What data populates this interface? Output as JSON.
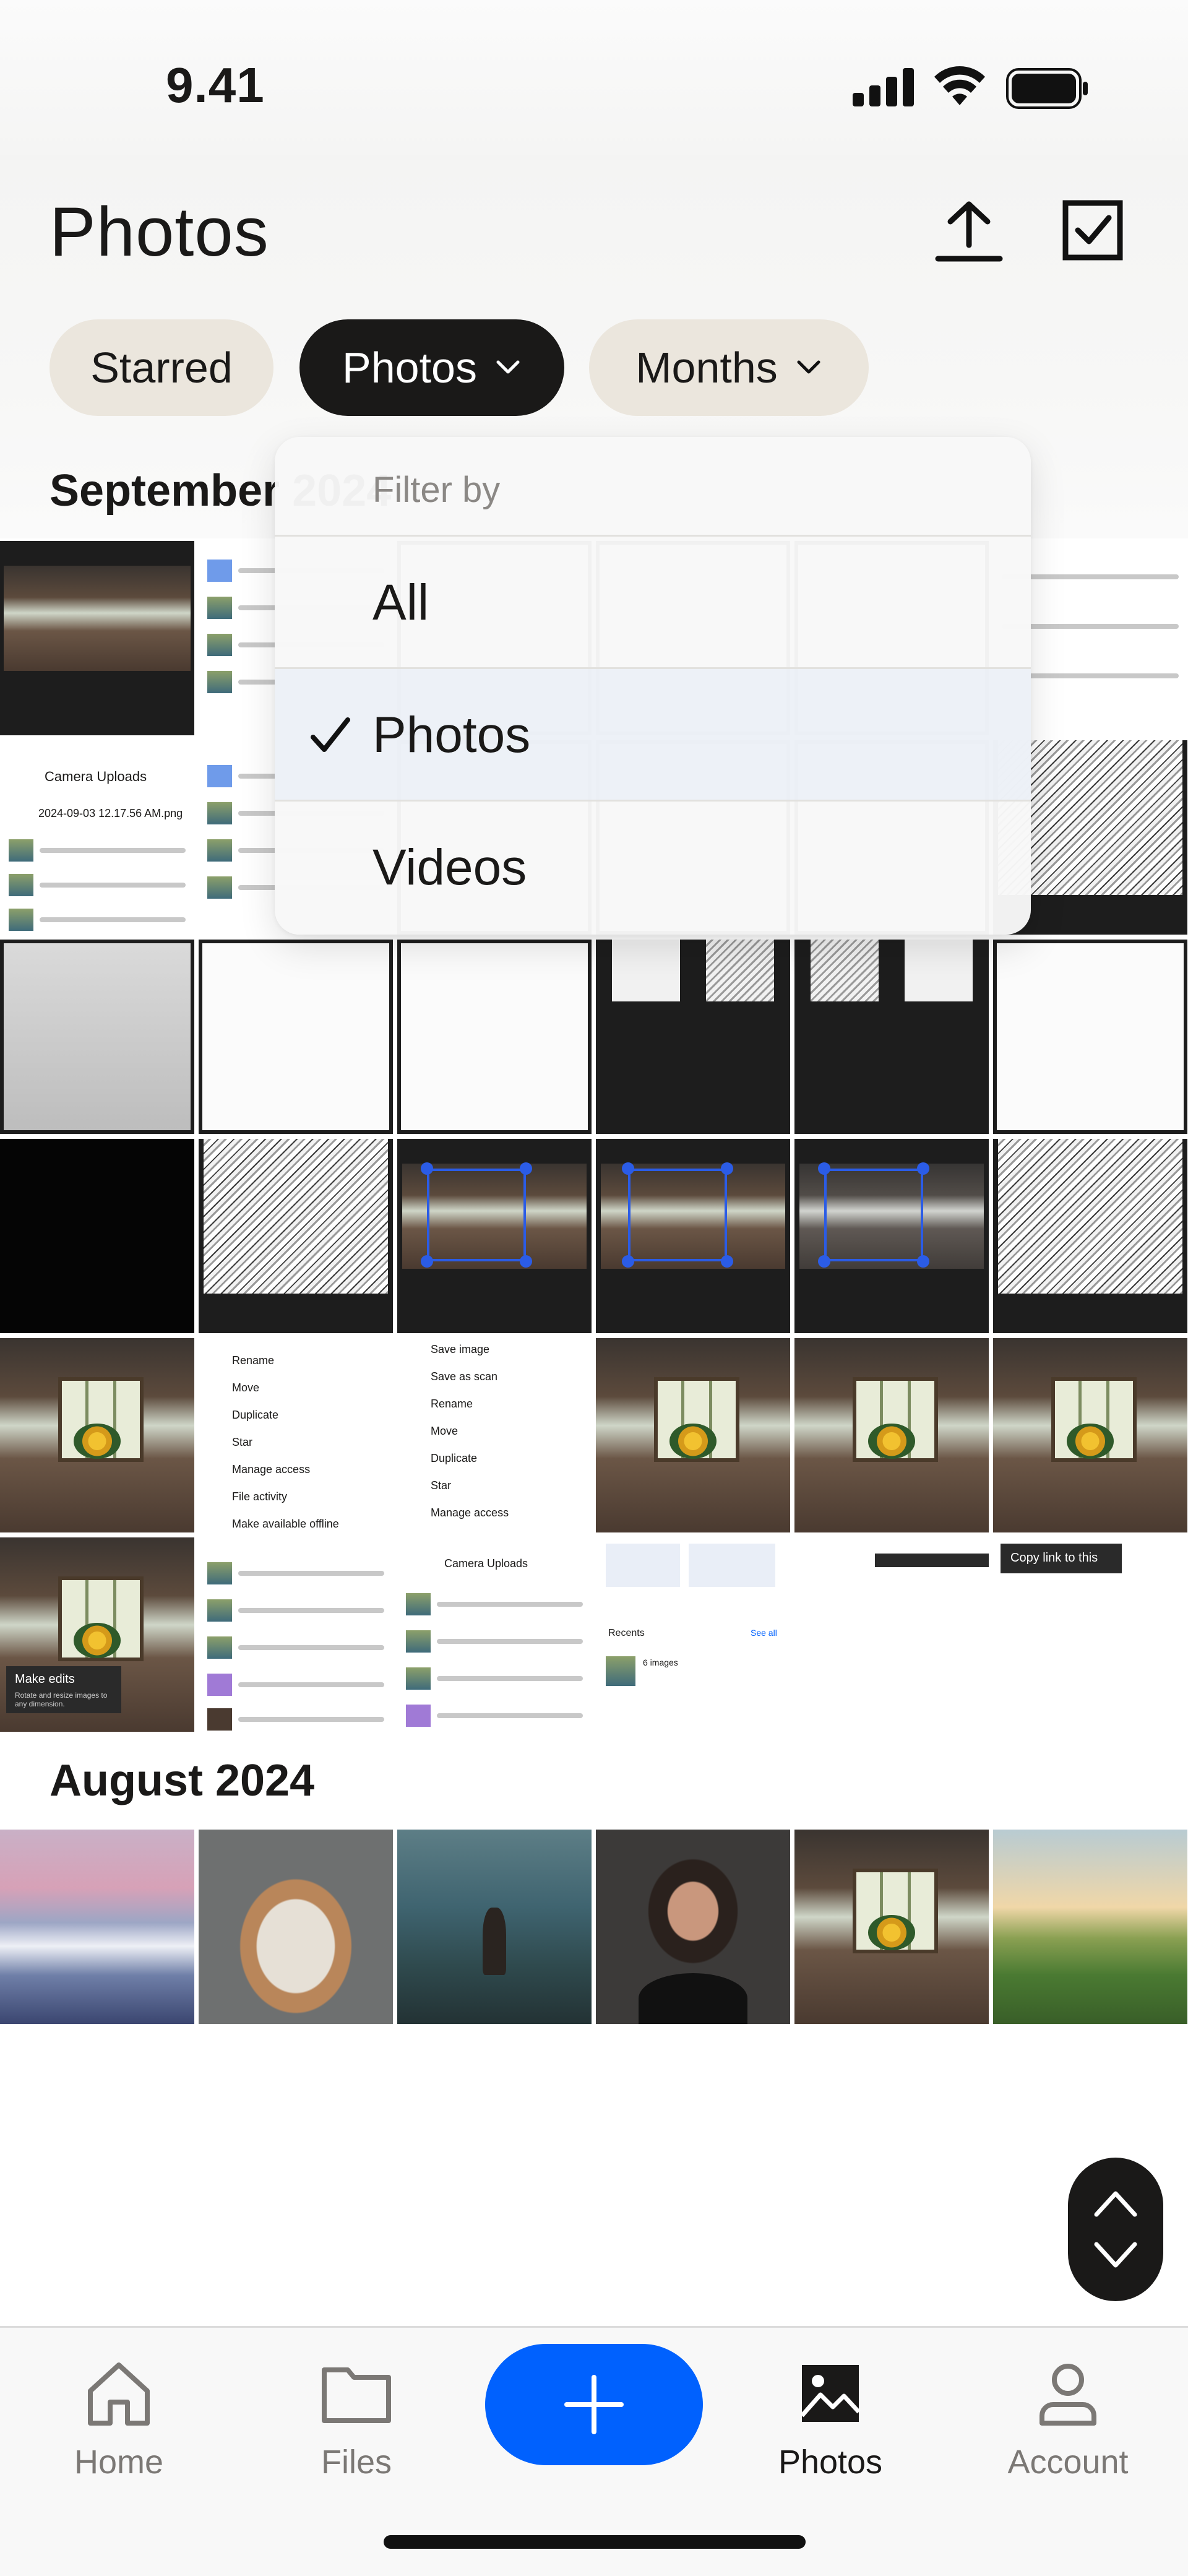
{
  "status_bar": {
    "time": "9.41"
  },
  "header": {
    "title": "Photos"
  },
  "filters": [
    {
      "label": "Starred",
      "selected": false
    },
    {
      "label": "Photos",
      "selected": true
    },
    {
      "label": "Months",
      "selected": false
    }
  ],
  "sections": [
    {
      "title": "September 2024"
    },
    {
      "title": "August 2024"
    }
  ],
  "dropdown": {
    "header": "Filter by",
    "options": [
      {
        "label": "All",
        "checked": false
      },
      {
        "label": "Photos",
        "checked": true
      },
      {
        "label": "Videos",
        "checked": false
      }
    ]
  },
  "tile_text": {
    "camera_uploads": "Camera Uploads",
    "filename": "2024-09-03 12.17.56 AM.png",
    "make_edits": "Make edits",
    "make_edits_sub": "Rotate and resize images to any dimension.",
    "copy_link": "Copy link to this",
    "recents": "Recents",
    "see_all": "See all",
    "images": "6 images",
    "menu_items": [
      "Rename",
      "Move",
      "Duplicate",
      "Star",
      "Manage access",
      "File activity",
      "Make available offline"
    ],
    "menu_items_2": [
      "Save image",
      "Save as scan",
      "Rename",
      "Move",
      "Duplicate",
      "Star",
      "Manage access"
    ]
  },
  "bottom_nav": {
    "home": "Home",
    "files": "Files",
    "photos": "Photos",
    "account": "Account"
  },
  "colors": {
    "accent": "#0061fe",
    "chip_dark": "#1a1918",
    "chip_light": "#ebe6dd"
  }
}
